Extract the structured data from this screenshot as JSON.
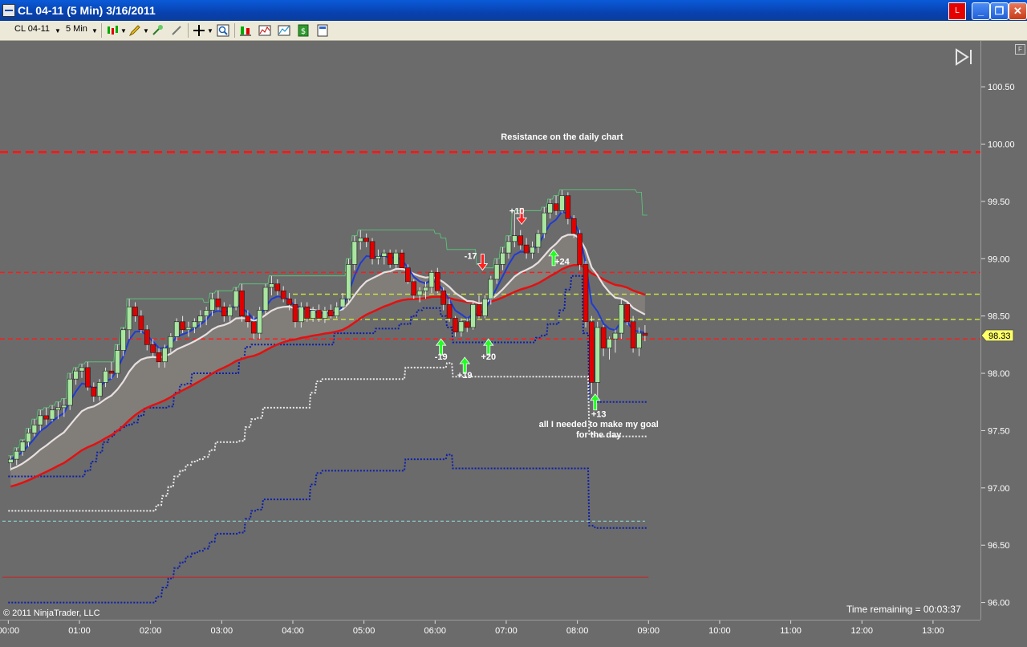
{
  "window": {
    "title": "CL 04-11 (5 Min)  3/16/2011",
    "link_label": "L"
  },
  "toolbar": {
    "instrument": "CL 04-11",
    "interval": "5 Min"
  },
  "footer": {
    "copyright": "© 2011 NinjaTrader, LLC",
    "time_remaining": "Time remaining = 00:03:37"
  },
  "colors": {
    "bull": "#a9e6a0",
    "bear": "#e00000",
    "background": "#6b6b6b",
    "ema_fast": "#1f3bd6",
    "ema_slow": "#e8e0e0",
    "sma_long": "#e41010",
    "keltner": "#0b1fae",
    "dotted_white": "#e9e9e9",
    "resistance": "#ff1a1a",
    "level_yellow": "#c8e23a"
  },
  "chart_data": {
    "type": "candlestick",
    "instrument": "CL 04-11",
    "interval": "5 Min",
    "date": "3/16/2011",
    "x_tick_labels": [
      "00:00",
      "01:00",
      "02:00",
      "03:00",
      "04:00",
      "05:00",
      "06:00",
      "07:00",
      "08:00",
      "09:00",
      "10:00",
      "11:00",
      "12:00",
      "13:00"
    ],
    "y_tick_labels": [
      "100.50",
      "100.00",
      "99.50",
      "99.00",
      "98.50",
      "98.00",
      "97.50",
      "97.00",
      "96.50",
      "96.00"
    ],
    "ylim": [
      95.85,
      100.9
    ],
    "xlim": [
      "23:53",
      "13:40"
    ],
    "last_price": "98.33",
    "candles": [
      {
        "t": "00:00",
        "o": 97.22,
        "h": 97.28,
        "l": 97.15,
        "c": 97.25
      },
      {
        "t": "00:05",
        "o": 97.25,
        "h": 97.35,
        "l": 97.2,
        "c": 97.32
      },
      {
        "t": "00:10",
        "o": 97.32,
        "h": 97.42,
        "l": 97.28,
        "c": 97.4
      },
      {
        "t": "00:15",
        "o": 97.4,
        "h": 97.52,
        "l": 97.36,
        "c": 97.48
      },
      {
        "t": "00:20",
        "o": 97.48,
        "h": 97.6,
        "l": 97.45,
        "c": 97.55
      },
      {
        "t": "00:25",
        "o": 97.55,
        "h": 97.68,
        "l": 97.5,
        "c": 97.63
      },
      {
        "t": "00:30",
        "o": 97.63,
        "h": 97.7,
        "l": 97.55,
        "c": 97.6
      },
      {
        "t": "00:35",
        "o": 97.6,
        "h": 97.72,
        "l": 97.58,
        "c": 97.68
      },
      {
        "t": "00:40",
        "o": 97.68,
        "h": 97.75,
        "l": 97.6,
        "c": 97.7
      },
      {
        "t": "00:45",
        "o": 97.7,
        "h": 97.78,
        "l": 97.62,
        "c": 97.72
      },
      {
        "t": "00:50",
        "o": 97.72,
        "h": 98.0,
        "l": 97.68,
        "c": 97.95
      },
      {
        "t": "00:55",
        "o": 97.95,
        "h": 98.05,
        "l": 97.9,
        "c": 98.02
      },
      {
        "t": "01:00",
        "o": 98.02,
        "h": 98.08,
        "l": 97.96,
        "c": 98.05
      },
      {
        "t": "01:05",
        "o": 98.05,
        "h": 98.1,
        "l": 97.85,
        "c": 97.88
      },
      {
        "t": "01:10",
        "o": 97.88,
        "h": 97.92,
        "l": 97.75,
        "c": 97.8
      },
      {
        "t": "01:15",
        "o": 97.8,
        "h": 97.95,
        "l": 97.76,
        "c": 97.92
      },
      {
        "t": "01:20",
        "o": 97.92,
        "h": 98.05,
        "l": 97.88,
        "c": 98.02
      },
      {
        "t": "01:25",
        "o": 98.02,
        "h": 98.1,
        "l": 97.95,
        "c": 98.0
      },
      {
        "t": "01:30",
        "o": 98.0,
        "h": 98.25,
        "l": 97.96,
        "c": 98.2
      },
      {
        "t": "01:35",
        "o": 98.2,
        "h": 98.4,
        "l": 98.15,
        "c": 98.38
      },
      {
        "t": "01:40",
        "o": 98.38,
        "h": 98.65,
        "l": 98.3,
        "c": 98.58
      },
      {
        "t": "01:45",
        "o": 98.58,
        "h": 98.62,
        "l": 98.45,
        "c": 98.5
      },
      {
        "t": "01:50",
        "o": 98.5,
        "h": 98.55,
        "l": 98.35,
        "c": 98.38
      },
      {
        "t": "01:55",
        "o": 98.38,
        "h": 98.42,
        "l": 98.2,
        "c": 98.25
      },
      {
        "t": "02:00",
        "o": 98.25,
        "h": 98.3,
        "l": 98.15,
        "c": 98.18
      },
      {
        "t": "02:05",
        "o": 98.18,
        "h": 98.22,
        "l": 98.05,
        "c": 98.1
      },
      {
        "t": "02:10",
        "o": 98.1,
        "h": 98.25,
        "l": 98.05,
        "c": 98.22
      },
      {
        "t": "02:15",
        "o": 98.22,
        "h": 98.35,
        "l": 98.18,
        "c": 98.32
      },
      {
        "t": "02:20",
        "o": 98.32,
        "h": 98.48,
        "l": 98.28,
        "c": 98.45
      },
      {
        "t": "02:25",
        "o": 98.45,
        "h": 98.5,
        "l": 98.35,
        "c": 98.38
      },
      {
        "t": "02:30",
        "o": 98.38,
        "h": 98.45,
        "l": 98.32,
        "c": 98.4
      },
      {
        "t": "02:35",
        "o": 98.4,
        "h": 98.48,
        "l": 98.35,
        "c": 98.45
      },
      {
        "t": "02:40",
        "o": 98.45,
        "h": 98.55,
        "l": 98.4,
        "c": 98.5
      },
      {
        "t": "02:45",
        "o": 98.5,
        "h": 98.58,
        "l": 98.42,
        "c": 98.55
      },
      {
        "t": "02:50",
        "o": 98.55,
        "h": 98.7,
        "l": 98.5,
        "c": 98.65
      },
      {
        "t": "02:55",
        "o": 98.65,
        "h": 98.72,
        "l": 98.55,
        "c": 98.58
      },
      {
        "t": "03:00",
        "o": 98.58,
        "h": 98.62,
        "l": 98.45,
        "c": 98.5
      },
      {
        "t": "03:05",
        "o": 98.5,
        "h": 98.6,
        "l": 98.45,
        "c": 98.58
      },
      {
        "t": "03:10",
        "o": 98.58,
        "h": 98.75,
        "l": 98.55,
        "c": 98.72
      },
      {
        "t": "03:15",
        "o": 98.72,
        "h": 98.78,
        "l": 98.45,
        "c": 98.5
      },
      {
        "t": "03:20",
        "o": 98.5,
        "h": 98.55,
        "l": 98.4,
        "c": 98.45
      },
      {
        "t": "03:25",
        "o": 98.45,
        "h": 98.5,
        "l": 98.3,
        "c": 98.35
      },
      {
        "t": "03:30",
        "o": 98.35,
        "h": 98.58,
        "l": 98.3,
        "c": 98.55
      },
      {
        "t": "03:35",
        "o": 98.55,
        "h": 98.78,
        "l": 98.5,
        "c": 98.75
      },
      {
        "t": "03:40",
        "o": 98.75,
        "h": 98.85,
        "l": 98.68,
        "c": 98.78
      },
      {
        "t": "03:45",
        "o": 98.78,
        "h": 98.82,
        "l": 98.68,
        "c": 98.72
      },
      {
        "t": "03:50",
        "o": 98.72,
        "h": 98.76,
        "l": 98.62,
        "c": 98.65
      },
      {
        "t": "03:55",
        "o": 98.65,
        "h": 98.7,
        "l": 98.55,
        "c": 98.6
      },
      {
        "t": "04:00",
        "o": 98.6,
        "h": 98.65,
        "l": 98.4,
        "c": 98.45
      },
      {
        "t": "04:05",
        "o": 98.45,
        "h": 98.62,
        "l": 98.4,
        "c": 98.58
      },
      {
        "t": "04:10",
        "o": 98.58,
        "h": 98.62,
        "l": 98.45,
        "c": 98.48
      },
      {
        "t": "04:15",
        "o": 98.48,
        "h": 98.58,
        "l": 98.45,
        "c": 98.55
      },
      {
        "t": "04:20",
        "o": 98.55,
        "h": 98.6,
        "l": 98.45,
        "c": 98.48
      },
      {
        "t": "04:25",
        "o": 98.48,
        "h": 98.58,
        "l": 98.44,
        "c": 98.55
      },
      {
        "t": "04:30",
        "o": 98.55,
        "h": 98.6,
        "l": 98.48,
        "c": 98.5
      },
      {
        "t": "04:35",
        "o": 98.5,
        "h": 98.62,
        "l": 98.48,
        "c": 98.58
      },
      {
        "t": "04:40",
        "o": 98.58,
        "h": 98.7,
        "l": 98.55,
        "c": 98.65
      },
      {
        "t": "04:45",
        "o": 98.65,
        "h": 99.0,
        "l": 98.6,
        "c": 98.95
      },
      {
        "t": "04:50",
        "o": 98.95,
        "h": 99.2,
        "l": 98.9,
        "c": 99.15
      },
      {
        "t": "04:55",
        "o": 99.15,
        "h": 99.25,
        "l": 99.08,
        "c": 99.18
      },
      {
        "t": "05:00",
        "o": 99.18,
        "h": 99.22,
        "l": 99.1,
        "c": 99.15
      },
      {
        "t": "05:05",
        "o": 99.15,
        "h": 99.18,
        "l": 98.95,
        "c": 99.0
      },
      {
        "t": "05:10",
        "o": 99.0,
        "h": 99.08,
        "l": 98.95,
        "c": 99.02
      },
      {
        "t": "05:15",
        "o": 99.02,
        "h": 99.08,
        "l": 98.95,
        "c": 99.05
      },
      {
        "t": "05:20",
        "o": 99.05,
        "h": 99.08,
        "l": 98.92,
        "c": 98.95
      },
      {
        "t": "05:25",
        "o": 98.95,
        "h": 99.08,
        "l": 98.92,
        "c": 99.05
      },
      {
        "t": "05:30",
        "o": 99.05,
        "h": 99.08,
        "l": 98.9,
        "c": 98.92
      },
      {
        "t": "05:35",
        "o": 98.92,
        "h": 98.95,
        "l": 98.78,
        "c": 98.8
      },
      {
        "t": "05:40",
        "o": 98.8,
        "h": 98.82,
        "l": 98.65,
        "c": 98.68
      },
      {
        "t": "05:45",
        "o": 98.68,
        "h": 98.75,
        "l": 98.62,
        "c": 98.72
      },
      {
        "t": "05:50",
        "o": 98.72,
        "h": 98.8,
        "l": 98.65,
        "c": 98.75
      },
      {
        "t": "05:55",
        "o": 98.75,
        "h": 98.9,
        "l": 98.7,
        "c": 98.88
      },
      {
        "t": "06:00",
        "o": 98.88,
        "h": 98.92,
        "l": 98.7,
        "c": 98.72
      },
      {
        "t": "06:05",
        "o": 98.72,
        "h": 98.75,
        "l": 98.55,
        "c": 98.6
      },
      {
        "t": "06:10",
        "o": 98.6,
        "h": 98.65,
        "l": 98.45,
        "c": 98.48
      },
      {
        "t": "06:15",
        "o": 98.48,
        "h": 98.5,
        "l": 98.32,
        "c": 98.36
      },
      {
        "t": "06:20",
        "o": 98.36,
        "h": 98.48,
        "l": 98.32,
        "c": 98.45
      },
      {
        "t": "06:25",
        "o": 98.45,
        "h": 98.48,
        "l": 98.36,
        "c": 98.4
      },
      {
        "t": "06:30",
        "o": 98.4,
        "h": 98.62,
        "l": 98.38,
        "c": 98.6
      },
      {
        "t": "06:35",
        "o": 98.6,
        "h": 98.68,
        "l": 98.48,
        "c": 98.5
      },
      {
        "t": "06:40",
        "o": 98.5,
        "h": 98.68,
        "l": 98.48,
        "c": 98.65
      },
      {
        "t": "06:45",
        "o": 98.65,
        "h": 98.85,
        "l": 98.6,
        "c": 98.82
      },
      {
        "t": "06:50",
        "o": 98.82,
        "h": 99.0,
        "l": 98.78,
        "c": 98.95
      },
      {
        "t": "06:55",
        "o": 98.95,
        "h": 99.1,
        "l": 98.9,
        "c": 99.05
      },
      {
        "t": "07:00",
        "o": 99.05,
        "h": 99.2,
        "l": 99.0,
        "c": 99.15
      },
      {
        "t": "07:05",
        "o": 99.15,
        "h": 99.42,
        "l": 99.1,
        "c": 99.2
      },
      {
        "t": "07:10",
        "o": 99.2,
        "h": 99.25,
        "l": 99.08,
        "c": 99.12
      },
      {
        "t": "07:15",
        "o": 99.12,
        "h": 99.18,
        "l": 99.0,
        "c": 99.05
      },
      {
        "t": "07:20",
        "o": 99.05,
        "h": 99.15,
        "l": 99.0,
        "c": 99.1
      },
      {
        "t": "07:25",
        "o": 99.1,
        "h": 99.25,
        "l": 99.05,
        "c": 99.22
      },
      {
        "t": "07:30",
        "o": 99.22,
        "h": 99.45,
        "l": 99.18,
        "c": 99.4
      },
      {
        "t": "07:35",
        "o": 99.4,
        "h": 99.52,
        "l": 99.35,
        "c": 99.48
      },
      {
        "t": "07:40",
        "o": 99.48,
        "h": 99.55,
        "l": 99.38,
        "c": 99.42
      },
      {
        "t": "07:45",
        "o": 99.42,
        "h": 99.6,
        "l": 99.4,
        "c": 99.55
      },
      {
        "t": "07:50",
        "o": 99.55,
        "h": 99.58,
        "l": 99.3,
        "c": 99.35
      },
      {
        "t": "07:55",
        "o": 99.35,
        "h": 99.38,
        "l": 99.18,
        "c": 99.22
      },
      {
        "t": "08:00",
        "o": 99.22,
        "h": 99.25,
        "l": 98.9,
        "c": 98.95
      },
      {
        "t": "08:05",
        "o": 98.95,
        "h": 98.98,
        "l": 98.4,
        "c": 98.45
      },
      {
        "t": "08:10",
        "o": 98.45,
        "h": 98.5,
        "l": 97.82,
        "c": 97.92
      },
      {
        "t": "08:15",
        "o": 97.92,
        "h": 98.45,
        "l": 97.8,
        "c": 98.4
      },
      {
        "t": "08:20",
        "o": 98.4,
        "h": 98.42,
        "l": 98.15,
        "c": 98.22
      },
      {
        "t": "08:25",
        "o": 98.22,
        "h": 98.32,
        "l": 98.12,
        "c": 98.3
      },
      {
        "t": "08:30",
        "o": 98.3,
        "h": 98.38,
        "l": 98.18,
        "c": 98.35
      },
      {
        "t": "08:35",
        "o": 98.35,
        "h": 98.65,
        "l": 98.3,
        "c": 98.6
      },
      {
        "t": "08:40",
        "o": 98.6,
        "h": 98.62,
        "l": 98.42,
        "c": 98.45
      },
      {
        "t": "08:45",
        "o": 98.45,
        "h": 98.5,
        "l": 98.18,
        "c": 98.22
      },
      {
        "t": "08:50",
        "o": 98.22,
        "h": 98.4,
        "l": 98.15,
        "c": 98.35
      },
      {
        "t": "08:55",
        "o": 98.35,
        "h": 98.42,
        "l": 98.28,
        "c": 98.33
      }
    ],
    "horizontal_lines": [
      {
        "name": "resistance-daily",
        "price": 99.93,
        "color": "#ff1a1a",
        "style": "dashed-thick",
        "x_from": "23:53",
        "x_to": "13:40"
      },
      {
        "name": "red-level-upper",
        "price": 98.88,
        "color": "#ff1a1a",
        "style": "dashed",
        "x_from": "23:53",
        "x_to": "13:40"
      },
      {
        "name": "red-level-lower",
        "price": 98.3,
        "color": "#ff1a1a",
        "style": "dashed",
        "x_from": "23:53",
        "x_to": "13:40"
      },
      {
        "name": "yellow-level-upper",
        "price": 98.69,
        "color": "#c8e23a",
        "style": "dashed",
        "x_from": "04:00",
        "x_to": "13:40"
      },
      {
        "name": "yellow-level-lower",
        "price": 98.47,
        "color": "#c8e23a",
        "style": "dashed",
        "x_from": "04:00",
        "x_to": "13:40"
      },
      {
        "name": "cyan-bottom",
        "price": 96.71,
        "color": "#8fe0e0",
        "style": "dashed-thin",
        "x_from": "23:55",
        "x_to": "08:57"
      },
      {
        "name": "red-bottom",
        "price": 96.22,
        "color": "#d02020",
        "style": "solid-thin",
        "x_from": "23:55",
        "x_to": "09:00"
      }
    ],
    "annotations": [
      {
        "text": "Resistance on the daily chart",
        "t": "07:47",
        "price": 100.04
      },
      {
        "text": "-17",
        "t": "06:30",
        "price": 99.0
      },
      {
        "text": "+10",
        "t": "07:09",
        "price": 99.39
      },
      {
        "text": "+24",
        "t": "07:47",
        "price": 98.95
      },
      {
        "text": "-19",
        "t": "06:05",
        "price": 98.12
      },
      {
        "text": "+19",
        "t": "06:25",
        "price": 97.96
      },
      {
        "text": "+20",
        "t": "06:45",
        "price": 98.12
      },
      {
        "text": "+13",
        "t": "08:18",
        "price": 97.62
      },
      {
        "text": "all I needed to make my goal",
        "t": "08:18",
        "price": 97.53
      },
      {
        "text": "for the day",
        "t": "08:18",
        "price": 97.44
      }
    ],
    "arrows": [
      {
        "dir": "down",
        "color": "red",
        "t": "06:40",
        "price": 98.9
      },
      {
        "dir": "down",
        "color": "red",
        "t": "07:13",
        "price": 99.3
      },
      {
        "dir": "up",
        "color": "green",
        "t": "06:05",
        "price": 98.3
      },
      {
        "dir": "up",
        "color": "green",
        "t": "06:25",
        "price": 98.14
      },
      {
        "dir": "up",
        "color": "green",
        "t": "06:45",
        "price": 98.3
      },
      {
        "dir": "up",
        "color": "green",
        "t": "07:40",
        "price": 99.08
      },
      {
        "dir": "up",
        "color": "green",
        "t": "08:15",
        "price": 97.82
      }
    ]
  }
}
